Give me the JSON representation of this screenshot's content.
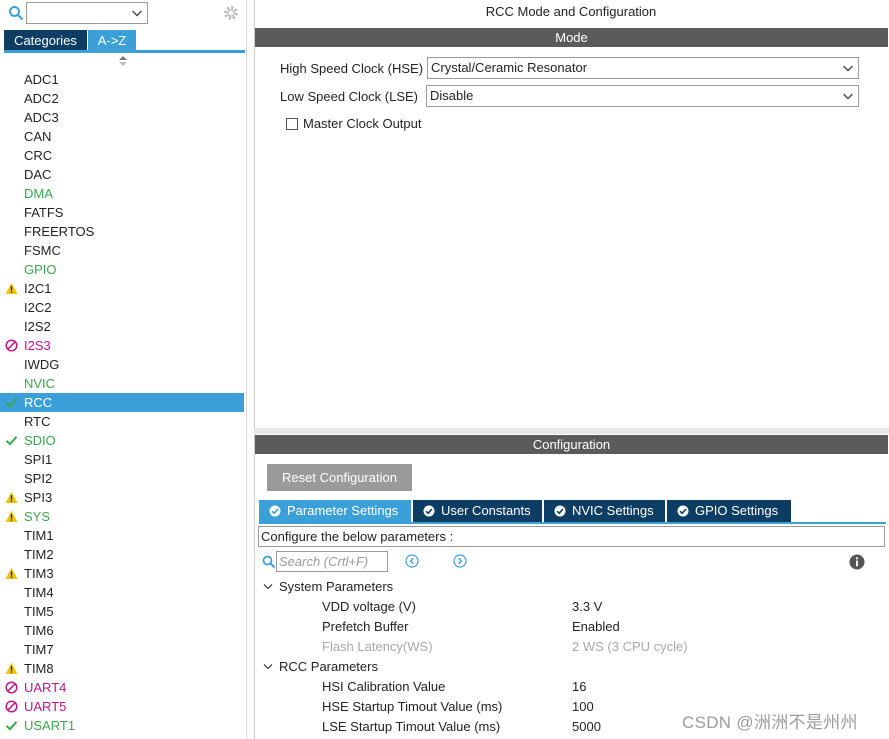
{
  "colors": {
    "dark_navy": "#0d3d63",
    "accent_blue": "#3ca0d8",
    "header_gray": "#5b5b5b",
    "ok_green": "#3aa74b",
    "warn_yellow": "#f2c400",
    "error_magenta": "#c0148b"
  },
  "left": {
    "search_icon": "search-icon",
    "settings_icon": "gear-icon",
    "tabs": {
      "categories": "Categories",
      "az": "A->Z"
    },
    "peripherals": [
      {
        "label": "ADC1",
        "status": "none"
      },
      {
        "label": "ADC2",
        "status": "none"
      },
      {
        "label": "ADC3",
        "status": "none"
      },
      {
        "label": "CAN",
        "status": "none"
      },
      {
        "label": "CRC",
        "status": "none"
      },
      {
        "label": "DAC",
        "status": "none"
      },
      {
        "label": "DMA",
        "status": "green"
      },
      {
        "label": "FATFS",
        "status": "none"
      },
      {
        "label": "FREERTOS",
        "status": "none"
      },
      {
        "label": "FSMC",
        "status": "none"
      },
      {
        "label": "GPIO",
        "status": "green"
      },
      {
        "label": "I2C1",
        "status": "warning"
      },
      {
        "label": "I2C2",
        "status": "none"
      },
      {
        "label": "I2S2",
        "status": "none"
      },
      {
        "label": "I2S3",
        "status": "error"
      },
      {
        "label": "IWDG",
        "status": "none"
      },
      {
        "label": "NVIC",
        "status": "green"
      },
      {
        "label": "RCC",
        "status": "selected"
      },
      {
        "label": "RTC",
        "status": "none"
      },
      {
        "label": "SDIO",
        "status": "ok"
      },
      {
        "label": "SPI1",
        "status": "none"
      },
      {
        "label": "SPI2",
        "status": "none"
      },
      {
        "label": "SPI3",
        "status": "warning"
      },
      {
        "label": "SYS",
        "status": "warning-green"
      },
      {
        "label": "TIM1",
        "status": "none"
      },
      {
        "label": "TIM2",
        "status": "none"
      },
      {
        "label": "TIM3",
        "status": "warning"
      },
      {
        "label": "TIM4",
        "status": "none"
      },
      {
        "label": "TIM5",
        "status": "none"
      },
      {
        "label": "TIM6",
        "status": "none"
      },
      {
        "label": "TIM7",
        "status": "none"
      },
      {
        "label": "TIM8",
        "status": "warning"
      },
      {
        "label": "UART4",
        "status": "error"
      },
      {
        "label": "UART5",
        "status": "error"
      },
      {
        "label": "USART1",
        "status": "ok"
      }
    ]
  },
  "mode": {
    "window_title": "RCC Mode and Configuration",
    "header": "Mode",
    "hse_label": "High Speed Clock (HSE)",
    "hse_value": "Crystal/Ceramic Resonator",
    "lse_label": "Low Speed Clock (LSE)",
    "lse_value": "Disable",
    "mco_label": "Master Clock Output",
    "mco_checked": false
  },
  "config": {
    "header": "Configuration",
    "reset_label": "Reset Configuration",
    "tabs": {
      "param": "Parameter Settings",
      "user": "User Constants",
      "nvic": "NVIC Settings",
      "gpio": "GPIO Settings"
    },
    "description": "Configure the below parameters :",
    "search_placeholder": "Search (Crtl+F)",
    "groups": {
      "system": {
        "title": "System Parameters",
        "rows": [
          {
            "label": "VDD voltage (V)",
            "value": "3.3 V"
          },
          {
            "label": "Prefetch Buffer",
            "value": "Enabled"
          },
          {
            "label": "Flash Latency(WS)",
            "value": "2 WS (3 CPU cycle)"
          }
        ]
      },
      "rcc": {
        "title": "RCC Parameters",
        "rows": [
          {
            "label": "HSI Calibration Value",
            "value": "16"
          },
          {
            "label": "HSE Startup Timout Value (ms)",
            "value": "100"
          },
          {
            "label": "LSE Startup Timout Value (ms)",
            "value": "5000"
          }
        ]
      }
    }
  },
  "watermark": "CSDN @洲洲不是州州"
}
